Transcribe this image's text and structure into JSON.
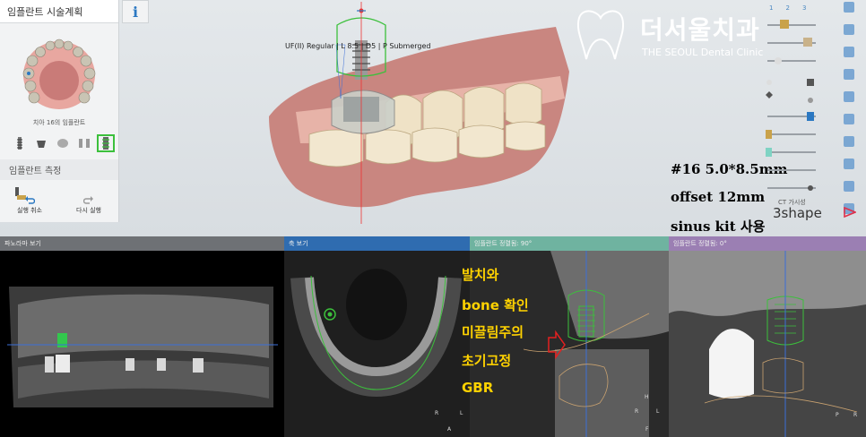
{
  "left_panel": {
    "title": "임플란트 시술계획",
    "info_label": "i",
    "thumb_caption": "치아 16의 임플란트",
    "measure_section": "임플란트 측정",
    "undo_label": "실행 취소",
    "redo_label": "다시 실행"
  },
  "scene": {
    "implant_label": "UF(II) Regular | L 8.5 | D5 | P Submerged"
  },
  "logo": {
    "korean": "더서울치과",
    "english": "THE SEOUL Dental Clinic"
  },
  "annotations": {
    "line1": "#16 5.0*8.5mm",
    "line2": "offset 12mm",
    "line3": "sinus kit 사용"
  },
  "slider_panel": {
    "numbers": [
      "1",
      "2",
      "3"
    ]
  },
  "brand": {
    "ct_tag": "CT 가시성",
    "name": "3shape"
  },
  "views": {
    "panoramic_title": "파노라마 보기",
    "axial_title": "축 보기",
    "cross1_title": "임플란트 정렬됨: 90°",
    "cross2_title": "임플란트 정렬됨: 0°"
  },
  "hand_notes": [
    "발치와",
    "bone 확인",
    "미끌림주의",
    "초기고정",
    "GBR"
  ],
  "orientation": {
    "v2": [
      "R",
      "L",
      "A"
    ],
    "v3": [
      "H",
      "R",
      "L",
      "F"
    ],
    "v4": [
      "P",
      "R"
    ]
  },
  "colors": {
    "implant_guide": "#3cc03c",
    "hand_note": "#ffd200",
    "crosshair": "#3b6fd8"
  }
}
